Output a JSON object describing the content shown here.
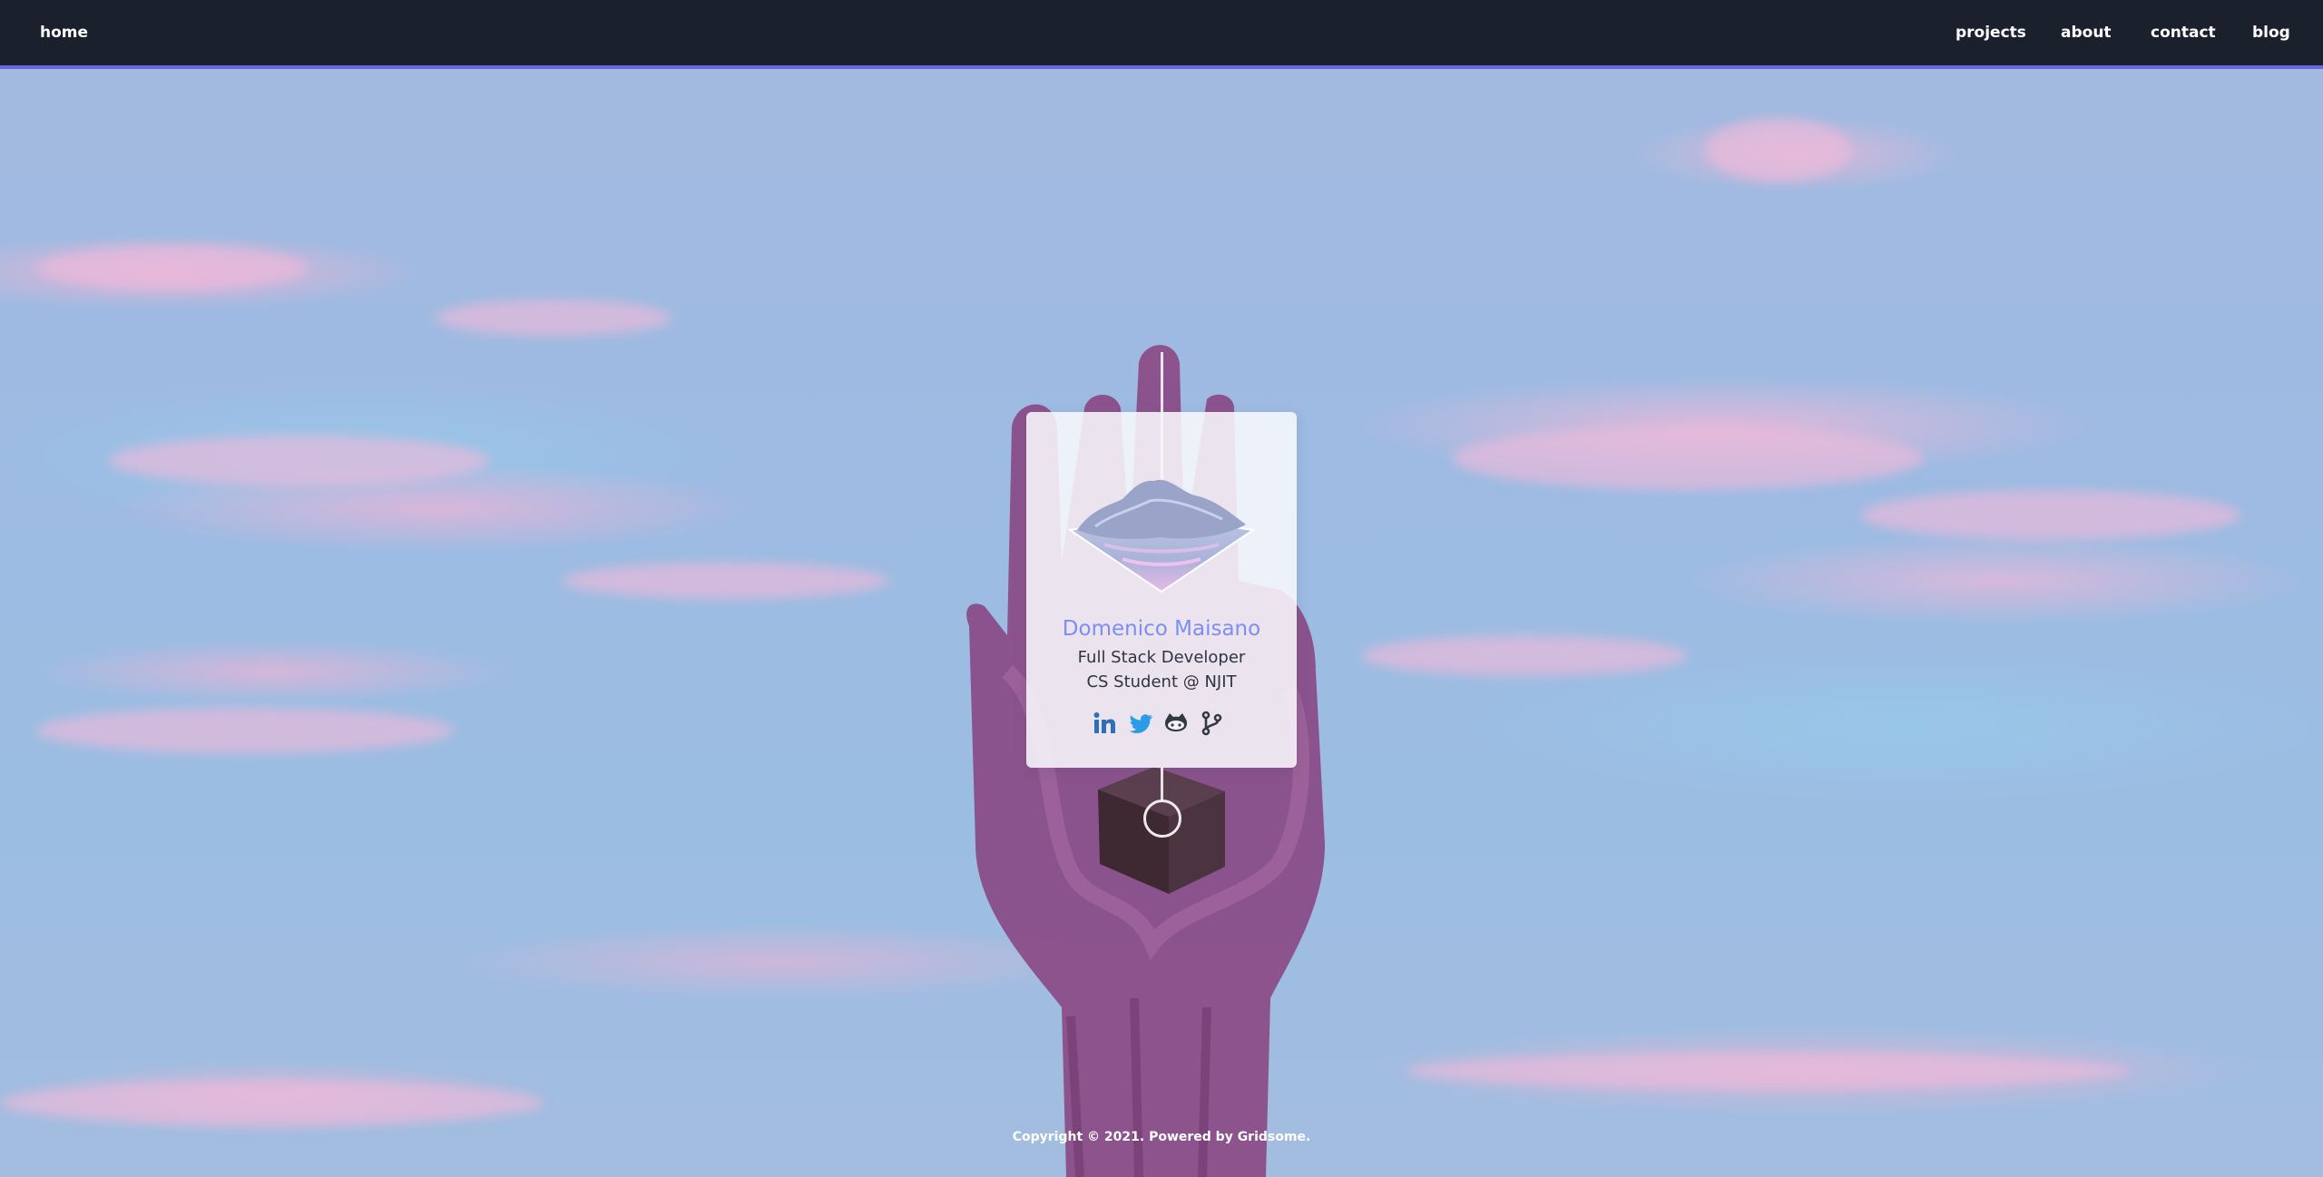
{
  "nav": {
    "home_label": "home",
    "links": [
      "projects",
      "about",
      "contact",
      "blog"
    ]
  },
  "profile": {
    "name": "Domenico Maisano",
    "role": "Full Stack Developer",
    "education": "CS Student @ NJIT",
    "socials": [
      "linkedin-icon",
      "twitter-icon",
      "github-icon",
      "git-branch-icon"
    ]
  },
  "footer": {
    "copyright": "Copyright © 2021. Powered by Gridsome."
  },
  "colors": {
    "nav_bg": "#1b202d",
    "nav_accent": "#6a66e0",
    "name_accent": "#7d8ef0",
    "linkedin": "#2f6fb5",
    "twitter": "#2d9ce8",
    "github": "#333845"
  }
}
